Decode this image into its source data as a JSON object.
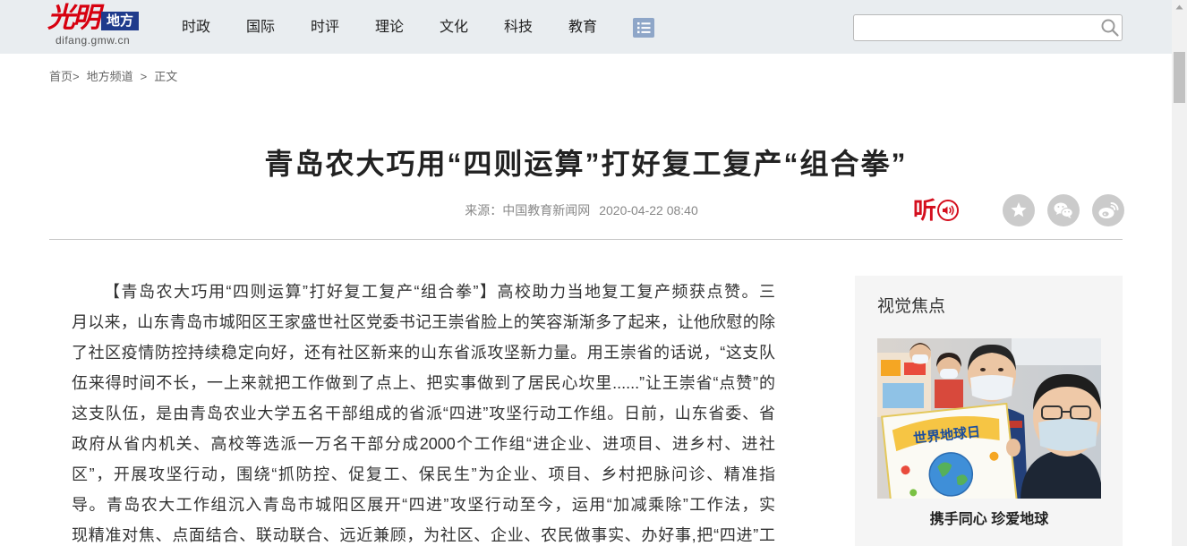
{
  "header": {
    "logo_main": "光明",
    "logo_badge": "地方",
    "logo_domain": "difang.gmw.cn",
    "nav": [
      "时政",
      "国际",
      "时评",
      "理论",
      "文化",
      "科技",
      "教育"
    ],
    "menu_icon": "list-menu-icon",
    "search": {
      "value": "",
      "icon": "search-icon"
    }
  },
  "breadcrumb": {
    "home": "首页",
    "channel": "地方频道",
    "current": "正文",
    "separator": ">"
  },
  "article": {
    "title": "青岛农大巧用“四则运算”打好复工复产“组合拳”",
    "source_prefix": "来源：",
    "source_name": "中国教育新闻网",
    "datetime": "2020-04-22 08:40",
    "listen_label": "听",
    "share_icons": [
      "star-icon",
      "wechat-icon",
      "weibo-icon"
    ],
    "paragraph_lines": [
      "【青岛农大巧用“四则运算”打好复工复产“组合拳”】高校助力当地复工复产频获点赞。三",
      "月以来，山东青岛市城阳区王家盛世社区党委书记王崇省脸上的笑容渐渐多了起来，让他欣慰的除",
      "了社区疫情防控持续稳定向好，还有社区新来的山东省派攻坚新力量。用王崇省的话说，“这支队",
      "伍来得时间不长，一上来就把工作做到了点上、把实事做到了居民心坎里......”让王崇省“点赞”的",
      "这支队伍，是由青岛农业大学五名干部组成的省派“四进”攻坚行动工作组。日前，山东省委、省",
      "政府从省内机关、高校等选派一万名干部分成2000个工作组“进企业、进项目、进乡村、进社",
      "区”，开展攻坚行动，围绕“抓防控、促复工、保民生”为企业、项目、乡村把脉问诊、精准指",
      "导。青岛农大工作组沉入青岛市城阳区展开“四进”攻坚行动至今，运用“加减乘除”工作法，实",
      "现精准对焦、点面结合、联动联合、远近兼顾，为社区、企业、农民做事实、办好事,把“四进”工"
    ]
  },
  "sidebar": {
    "heading": "视觉焦点",
    "focus_image": {
      "poster_text": "世界地球日"
    },
    "caption": "携手同心 珍爱地球"
  },
  "colors": {
    "header_bg": "#e9edf0",
    "brand_red": "#d7000f",
    "brand_navy": "#1f3b8c",
    "listen_red": "#d40f1e",
    "sidebar_bg": "#f5f5f5",
    "share_icon_bg": "#cbcbcb",
    "body_text": "#333333"
  }
}
